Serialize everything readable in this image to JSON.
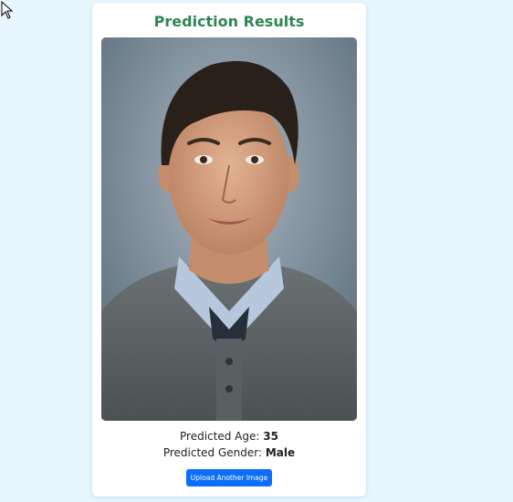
{
  "card": {
    "title": "Prediction Results"
  },
  "photo": {
    "alt": "Uploaded portrait photo"
  },
  "results": {
    "age_label": "Predicted Age:",
    "age_value": "35",
    "gender_label": "Predicted Gender:",
    "gender_value": "Male"
  },
  "actions": {
    "upload_label": "Upload Another Image"
  },
  "colors": {
    "background": "#e6f5fe",
    "title": "#2e8555",
    "button": "#0d6efd"
  }
}
